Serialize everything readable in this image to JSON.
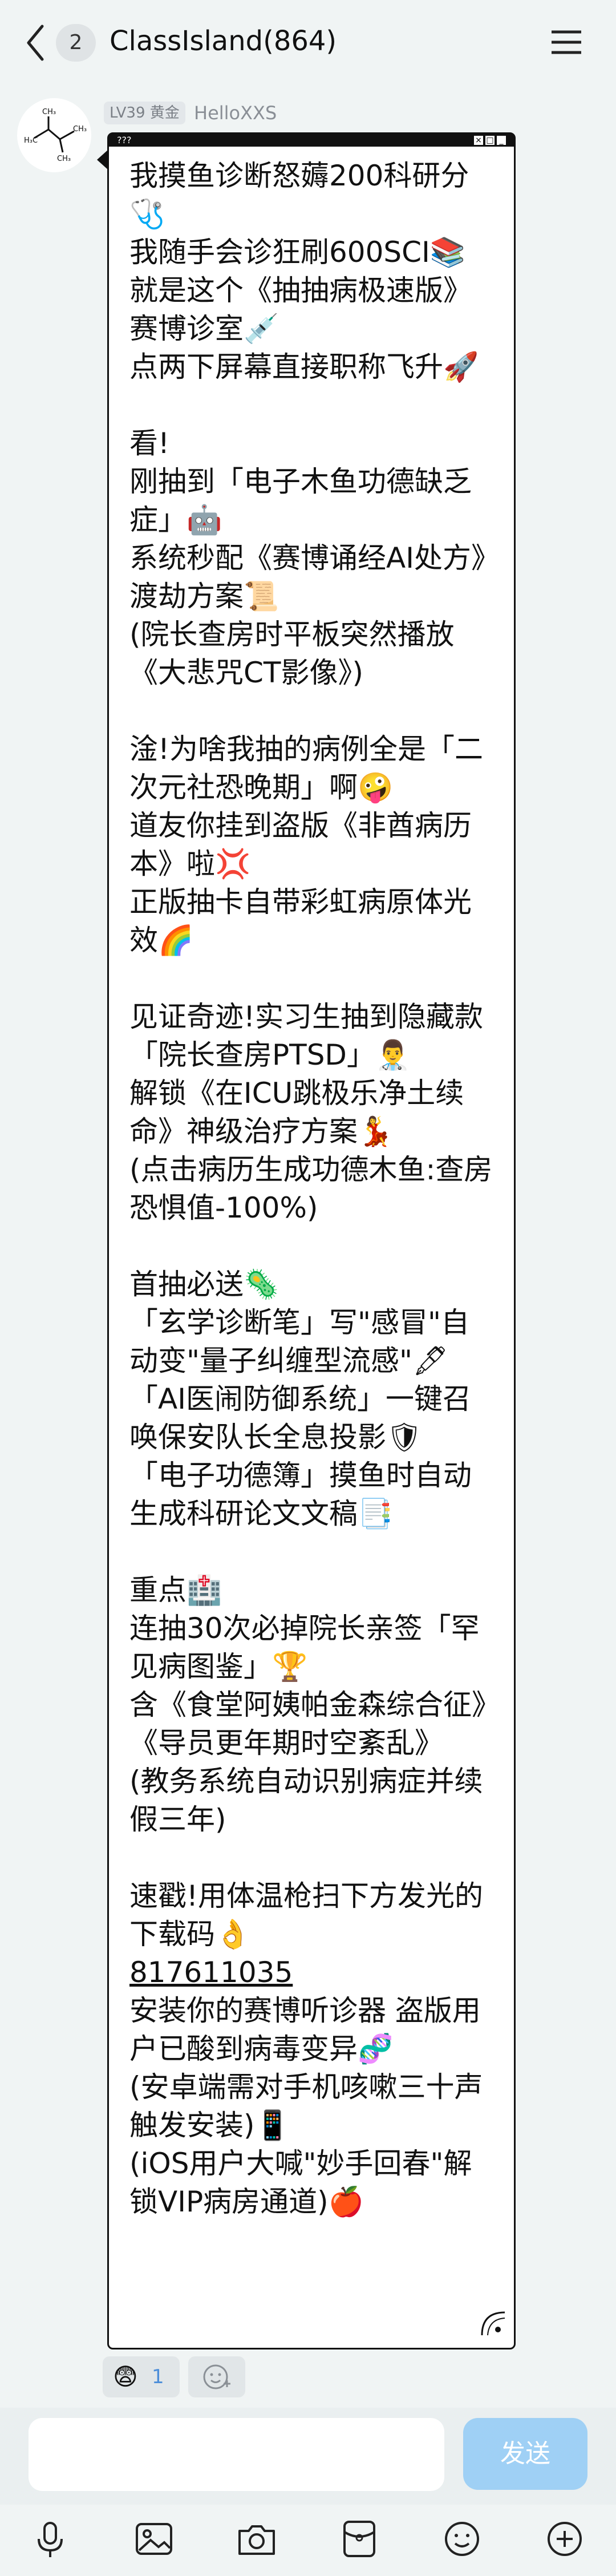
{
  "header": {
    "unread_count": "2",
    "title": "ClassIsland(864)"
  },
  "message": {
    "level_badge": "LV39 黄金",
    "sender": "HelloXXS",
    "window_bar_title": "???",
    "text_part1": "我摸鱼诊断怒薅200科研分🩺\n我随手会诊狂刷600SCI📚\n就是这个《抽抽病极速版》赛博诊室💉\n点两下屏幕直接职称飞升🚀\n\n看!\n刚抽到「电子木鱼功德缺乏症」🤖\n系统秒配《赛博诵经AI处方》渡劫方案📜\n(院长查房时平板突然播放《大悲咒CT影像》)\n\n淦!为啥我抽的病例全是「二次元社恐晚期」啊🤪\n道友你挂到盗版《非酋病历本》啦💢\n正版抽卡自带彩虹病原体光效🌈\n\n见证奇迹!实习生抽到隐藏款「院长查房PTSD」👨‍⚕️\n解锁《在ICU跳极乐净土续命》神级治疗方案💃\n(点击病历生成功德木鱼:查房恐惧值-100%)\n\n首抽必送🦠\n「玄学诊断笔」写\"感冒\"自动变\"量子纠缠型流感\"🖋\n「AI医闹防御系统」一键召唤保安队长全息投影🛡\n「电子功德簿」摸鱼时自动生成科研论文文稿📑\n\n重点🏥\n连抽30次必掉院长亲签「罕见病图鉴」🏆\n含《食堂阿姨帕金森综合征》《导员更年期时空紊乱》\n(教务系统自动识别病症并续假三年)\n\n速戳!用体温枪扫下方发光的下载码👌\n",
    "link_text": "817611035",
    "text_part2": "\n安装你的赛博听诊器 盗版用户已酸到病毒变异🧬\n(安卓端需对手机咳嗽三十声触发安装)📱\n(iOS用户大喊\"妙手回春\"解锁VIP病房通道)🍎"
  },
  "reactions": [
    {
      "emoji": "😨",
      "count": "1"
    }
  ],
  "input": {
    "placeholder": "",
    "send_label": "发送"
  },
  "toolbar": [
    "microphone-icon",
    "image-icon",
    "camera-icon",
    "red-packet-icon",
    "emoji-icon",
    "plus-icon"
  ]
}
